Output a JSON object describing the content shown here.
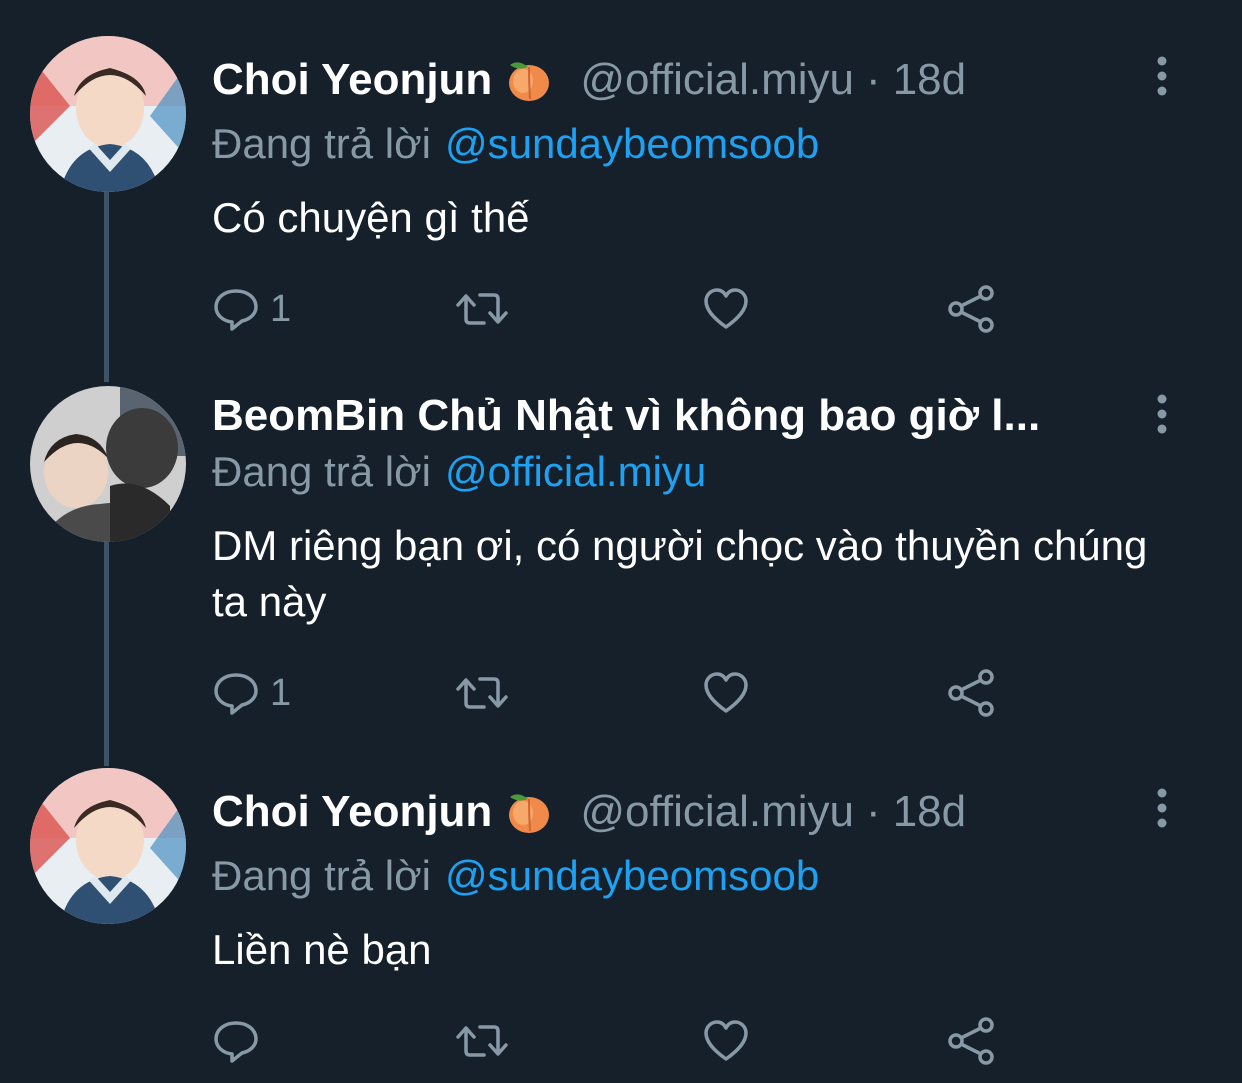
{
  "tweets": [
    {
      "name": "Choi Yeonjun",
      "emoji": "peach-emoji",
      "handle": "@official.miyu",
      "separator": "·",
      "time": "18d",
      "replying_prefix": "Đang trả lời",
      "replying_to": "@sundaybeomsoob",
      "text": "Có chuyện gì thế",
      "reply_count": "1"
    },
    {
      "name": "BeomBin Chủ Nhật vì không bao giờ l...",
      "replying_prefix": "Đang trả lời",
      "replying_to": "@official.miyu",
      "text": "DM riêng bạn ơi, có người chọc vào thuyền chúng ta này",
      "reply_count": "1"
    },
    {
      "name": "Choi Yeonjun",
      "emoji": "peach-emoji",
      "handle": "@official.miyu",
      "separator": "·",
      "time": "18d",
      "replying_prefix": "Đang trả lời",
      "replying_to": "@sundaybeomsoob",
      "text": "Liền nè bạn",
      "reply_count": ""
    }
  ],
  "icons": {
    "reply": "reply-icon",
    "retweet": "retweet-icon",
    "like": "heart-icon",
    "share": "share-icon",
    "more": "more-vertical-icon"
  },
  "colors": {
    "background": "#15202b",
    "secondary_text": "#8899a6",
    "link": "#1da1f2",
    "thread_line": "#3d5466"
  }
}
